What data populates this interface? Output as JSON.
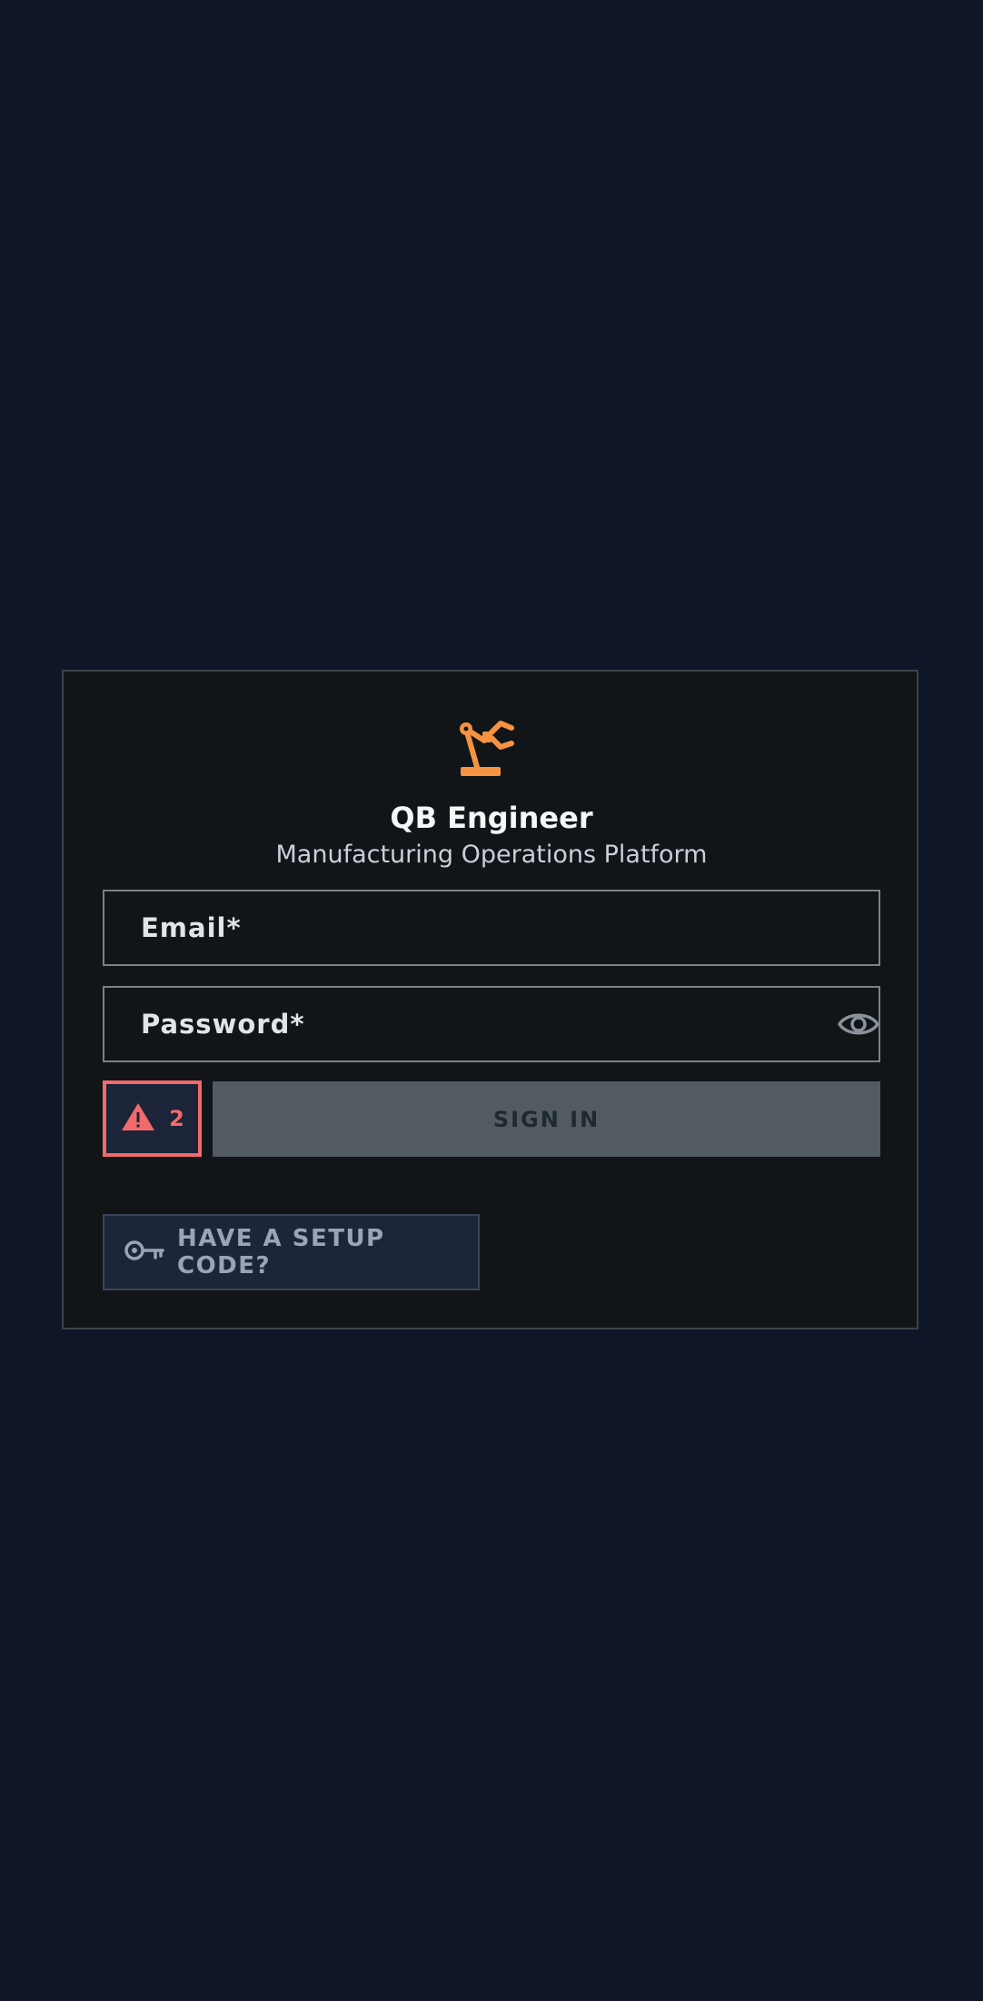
{
  "app": {
    "title": "QB Engineer",
    "subtitle": "Manufacturing Operations Platform",
    "brand_icon": "robot-arm-icon",
    "accent_color": "#f59342"
  },
  "login_form": {
    "email": {
      "label": "Email*",
      "value": ""
    },
    "password": {
      "label": "Password*",
      "value": "",
      "toggle_icon": "eye-icon"
    },
    "error_badge": {
      "icon": "warning-icon",
      "count": "2",
      "color": "#f26a6a"
    },
    "signin_label": "SIGN IN",
    "setup_code": {
      "icon": "key-icon",
      "label": "HAVE A SETUP CODE?"
    }
  },
  "colors": {
    "background": "#0f1628",
    "card": "#111517",
    "button_disabled": "#525a62"
  }
}
